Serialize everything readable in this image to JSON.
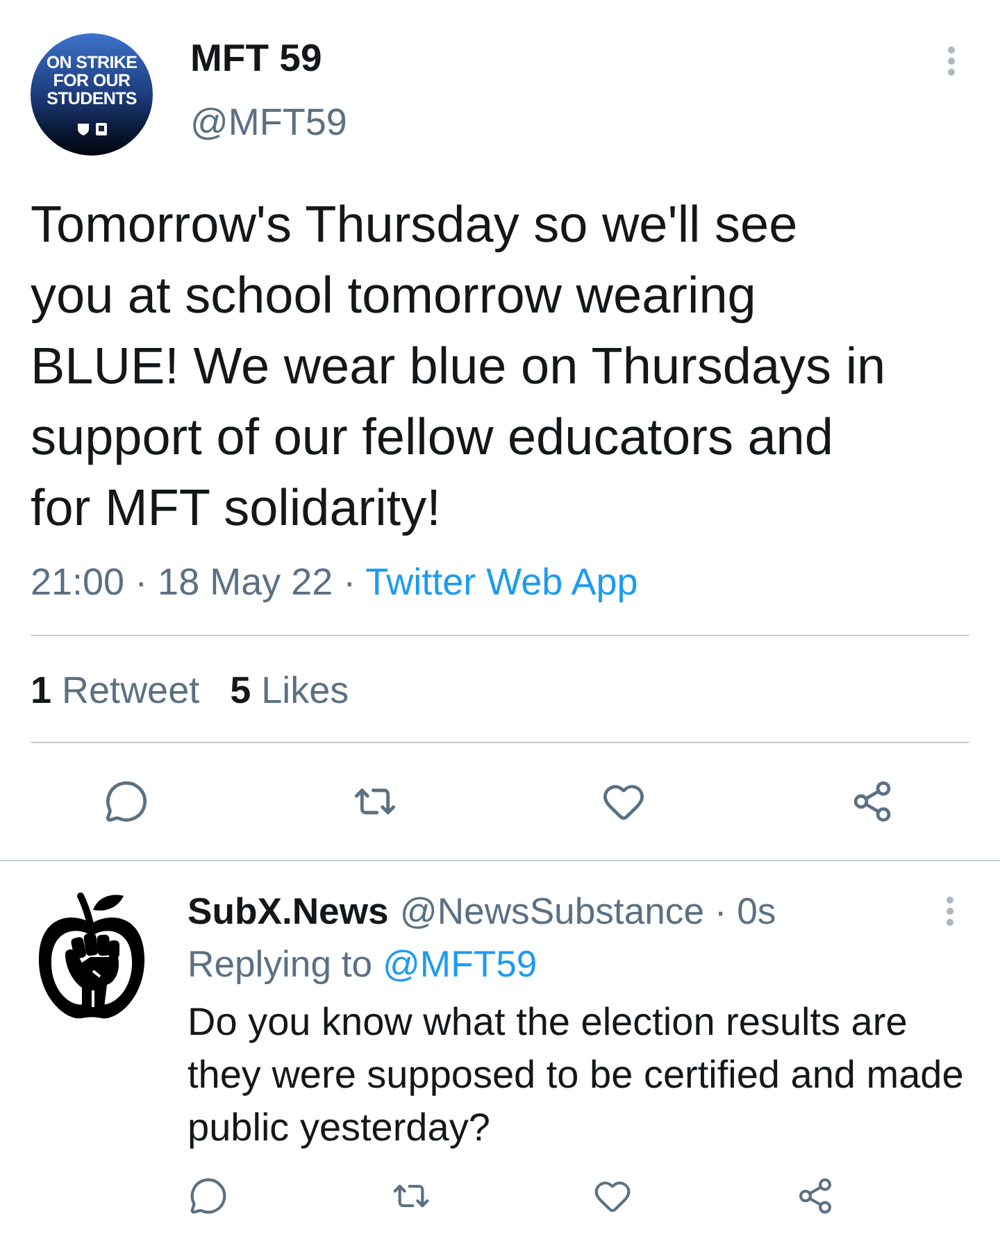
{
  "tweet": {
    "avatar": {
      "slogan_lines": [
        "ON STRIKE",
        "FOR OUR",
        "STUDENTS"
      ]
    },
    "name": "MFT 59",
    "handle": "@MFT59",
    "text": "Tomorrow's Thursday so we'll see you at school tomorrow wearing BLUE! We wear blue on Thursdays in support of our fellow educators and for MFT solidarity!",
    "timestamp": "21:00 · 18 May 22 ·",
    "source": "Twitter Web App",
    "stats": [
      {
        "count": "1",
        "label": "Retweet"
      },
      {
        "count": "5",
        "label": "Likes"
      }
    ]
  },
  "reply": {
    "name": "SubX.News",
    "handle_time": "@NewsSubstance · 0s",
    "replying_label": "Replying to",
    "replying_to": "@MFT59",
    "text": "Do you know what the election results are they were supposed to be certified and made public yesterday?"
  }
}
